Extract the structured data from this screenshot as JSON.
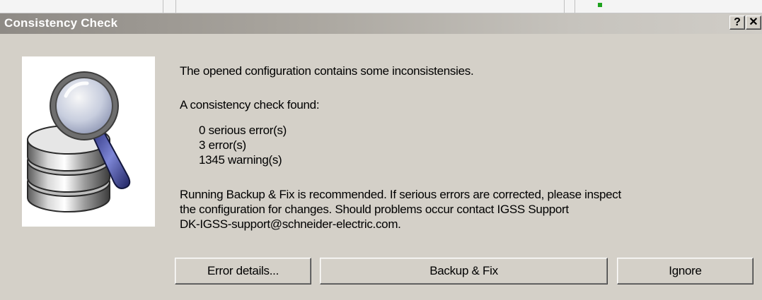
{
  "dialog": {
    "title": "Consistency Check",
    "help_glyph": "?",
    "close_glyph": "✕",
    "icon": "database-magnifier-icon"
  },
  "message": {
    "intro": "The opened configuration contains some inconsistensies.",
    "found": "A consistency check found:",
    "counts": [
      "0 serious error(s)",
      "3 error(s)",
      "1345 warning(s)"
    ],
    "recommendation": [
      "Running Backup & Fix is recommended. If serious errors are corrected, please inspect",
      "the configuration for changes. Should problems occur contact IGSS Support",
      "DK-IGSS-support@schneider-electric.com."
    ]
  },
  "buttons": {
    "error_details": "Error details...",
    "backup_fix": "Backup & Fix",
    "ignore": "Ignore"
  }
}
